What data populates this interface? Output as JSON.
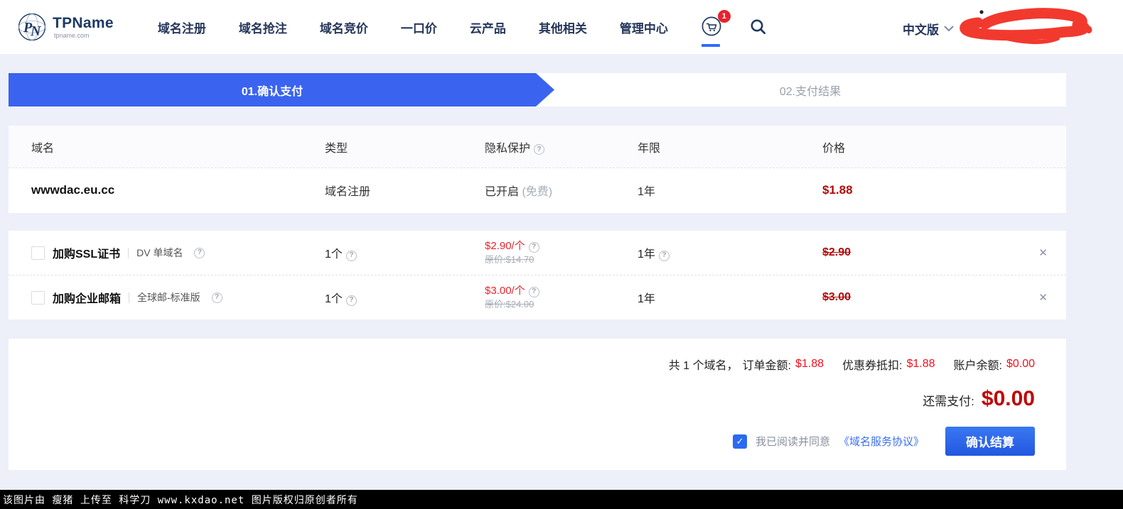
{
  "brand": {
    "name": "TPName",
    "domain": "tpname.com"
  },
  "nav": {
    "items": [
      "域名注册",
      "域名抢注",
      "域名竞价",
      "一口价",
      "云产品",
      "其他相关",
      "管理中心"
    ],
    "cart_badge": "1",
    "language": "中文版"
  },
  "steps": [
    {
      "label": "01.确认支付"
    },
    {
      "label": "02.支付结果"
    }
  ],
  "table": {
    "headers": [
      "域名",
      "类型",
      "隐私保护",
      "年限",
      "价格"
    ],
    "row": {
      "domain": "wwwdac.eu.cc",
      "type": "域名注册",
      "privacy": "已开启",
      "privacy_note": "(免费)",
      "years": "1年",
      "price": "$1.88"
    }
  },
  "addons": {
    "0": {
      "title": "加购SSL证书",
      "subtitle": "DV 单域名",
      "qty": "1个",
      "unit_price": "$2.90/个",
      "original_price": "原价:$14.70",
      "years": "1年",
      "total": "$2.90"
    },
    "1": {
      "title": "加购企业邮箱",
      "subtitle": "全球邮-标准版",
      "qty": "1个",
      "unit_price": "$3.00/个",
      "original_price": "原价:$24.00",
      "years": "1年",
      "total": "$3.00"
    }
  },
  "summary": {
    "count_label": "共 1 个域名，",
    "order_label": "订单金额:",
    "order_value": "$1.88",
    "coupon_label": "优惠券抵扣:",
    "coupon_value": "$1.88",
    "balance_label": "账户余额:",
    "balance_value": "$0.00",
    "due_label": "还需支付:",
    "due_value": "$0.00",
    "agree_text": "我已阅读并同意",
    "agreement_link": "《域名服务协议》",
    "checkout_label": "确认结算"
  },
  "icons": {
    "help": "?",
    "close": "✕",
    "check": "✓"
  },
  "colors": {
    "accent": "#3a63f0",
    "price_red": "#b30909",
    "bright_red": "#f50f1e",
    "badge_red": "#e8232e"
  },
  "watermark": "该图片由 瘦猪 上传至 科学刀 www.kxdao.net 图片版权归原创者所有"
}
